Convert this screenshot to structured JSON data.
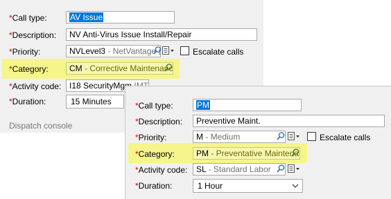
{
  "back_form": {
    "call_type": {
      "label": "Call type:",
      "value": "AV Issue"
    },
    "description": {
      "label": "Description:",
      "value": "NV Anti-Virus Issue Install/Repair"
    },
    "priority": {
      "label": "Priority:",
      "code": "NVLevel3",
      "desc": " - NetVantage (",
      "escalate_label": "Escalate calls"
    },
    "category": {
      "label": "Category:",
      "code": "CM",
      "desc": " - Corrective Maintenance"
    },
    "activity_code": {
      "label": "Activity code:",
      "code": "I18 SecurityMgm",
      "desc": " IMT1"
    },
    "duration": {
      "label": "Duration:",
      "value": "15  Minutes"
    },
    "dispatch_label": "Dispatch console"
  },
  "front_form": {
    "call_type": {
      "label": "Call type:",
      "value": "PM"
    },
    "description": {
      "label": "Description:",
      "value": "Preventive Maint."
    },
    "priority": {
      "label": "Priority:",
      "code": "M",
      "desc": " - Medium",
      "escalate_label": "Escalate calls"
    },
    "category": {
      "label": "Category:",
      "code": "PM",
      "desc": " - Preventative Maintenar"
    },
    "activity_code": {
      "label": "Activity code:",
      "code": "SL",
      "desc": " - Standard Labor"
    },
    "duration": {
      "label": "Duration:",
      "value": "1 Hour"
    }
  },
  "required_marker": "*",
  "colors": {
    "required": "#d40000",
    "highlight": "#f5f58c",
    "selection": "#0078d7",
    "panel": "#f0f0f0"
  },
  "icons": [
    "magnifier-icon",
    "details-icon",
    "chevron-down-icon"
  ]
}
